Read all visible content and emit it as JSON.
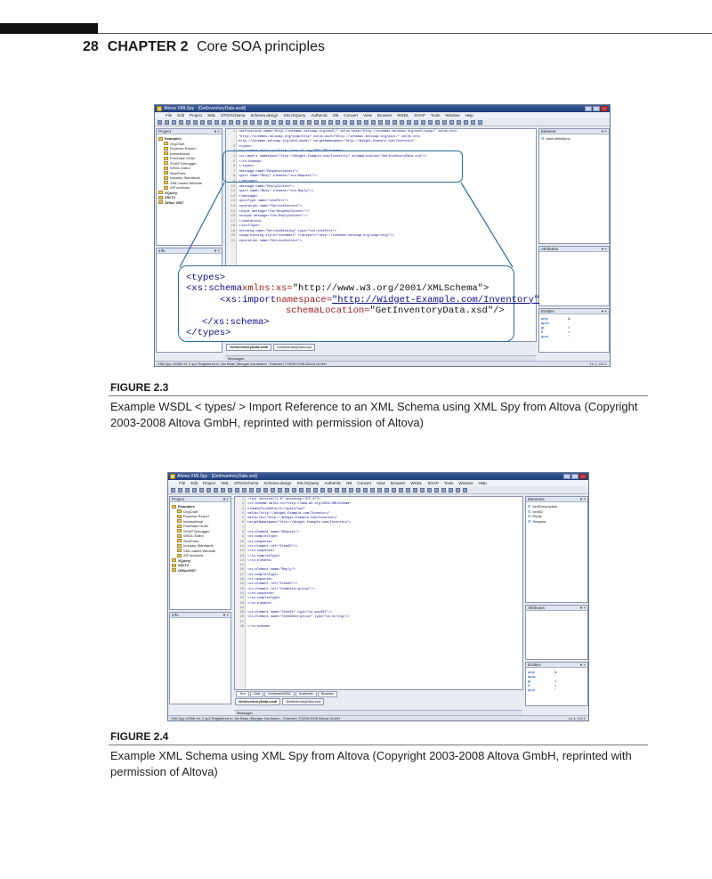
{
  "page": {
    "number": "28",
    "chapter": "CHAPTER 2",
    "chapter_title": "Core SOA principles"
  },
  "figure_2_3": {
    "label": "FIGURE 2.3",
    "caption": "Example WSDL < types/ > Import Reference to an XML Schema using XML Spy from Altova (Copyright 2003-2008 Altova GmbH, reprinted with permission of Altova)",
    "window": {
      "title": "Altova XMLSpy - [GetInventoryData.wsdl]",
      "menu": [
        "File",
        "Edit",
        "Project",
        "XML",
        "DTD/Schema",
        "Schema design",
        "XSL/XQuery",
        "Authentic",
        "DB",
        "Convert",
        "View",
        "Browser",
        "WSDL",
        "SOAP",
        "Tools",
        "Window",
        "Help"
      ],
      "project_pane_title": "Project",
      "project_tree": [
        {
          "label": "Examples",
          "kind": "root"
        },
        {
          "label": "OrgChart",
          "kind": "child"
        },
        {
          "label": "Expense Report",
          "kind": "child"
        },
        {
          "label": "International",
          "kind": "child"
        },
        {
          "label": "Purchase Order",
          "kind": "child"
        },
        {
          "label": "SOAP Debugger",
          "kind": "child"
        },
        {
          "label": "WSDL Editor",
          "kind": "child"
        },
        {
          "label": "SinePorts",
          "kind": "child"
        },
        {
          "label": "Industry Standards",
          "kind": "child"
        },
        {
          "label": "XML-based Website",
          "kind": "child"
        },
        {
          "label": "ZIP archives",
          "kind": "child"
        },
        {
          "label": "XQuery",
          "kind": "bold"
        },
        {
          "label": "XSLT2",
          "kind": "bold"
        },
        {
          "label": "Office 2007",
          "kind": "bold"
        }
      ],
      "info_pane_title": "Info",
      "element_pane_title": "Element",
      "element_items": [
        "wsdl:definitions"
      ],
      "attributes_pane_title": "Attributes",
      "entities_pane_title": "Entities",
      "entities": [
        {
          "name": "amp",
          "value": "&"
        },
        {
          "name": "apos",
          "value": "'"
        },
        {
          "name": "gt",
          "value": ">"
        },
        {
          "name": "lt",
          "value": "<"
        },
        {
          "name": "quot",
          "value": "\""
        }
      ],
      "code_lines": [
        {
          "n": "1",
          "t": "<definitions name=\"http://schemas.xmlsoap.org/wsdl/\" xmlns:soap=\"http://schemas.xmlsoap.org/wsdl/soap/\" xmlns:xsd="
        },
        {
          "n": "",
          "t": "\"http://schemas.xmlsoap.org/soap/http\" xmlns:wsdl=\"http://schemas.xmlsoap.org/wsdl/\" xmlns:tns="
        },
        {
          "n": "",
          "t": "http://schemas.xmlsoap.org/wsdl/mime/\" targetNamespace=\"http://Widget-Example.com/Inventory\""
        },
        {
          "n": "2",
          "t": "<types>"
        },
        {
          "n": "3",
          "t": "  <xs:schema xmlns:xs=\"http://www.w3.org/2001/XMLSchema\">"
        },
        {
          "n": "4",
          "t": "    <xs:import namespace=\"http://Widget-Example.com/Inventory\" schemaLocation=\"GetInventoryData.xsd\"/>"
        },
        {
          "n": "5",
          "t": "  </xs:schema>"
        },
        {
          "n": "6",
          "t": "</types>"
        },
        {
          "n": "7",
          "t": "<message name=\"RequestContext\">"
        },
        {
          "n": "8",
          "t": "  <part name=\"Body\" element=\"tns:Request\"/>"
        },
        {
          "n": "9",
          "t": "</message>"
        },
        {
          "n": "10",
          "t": "<message name=\"ReplyContext\">"
        },
        {
          "n": "11",
          "t": "  <part name=\"Body\" element=\"tns:Reply\"/>"
        },
        {
          "n": "12",
          "t": "</message>"
        },
        {
          "n": "13",
          "t": "<portType name=\"testPort\">"
        },
        {
          "n": "14",
          "t": "  <operation name=\"ServiceContext\">"
        },
        {
          "n": "15",
          "t": "    <input message=\"tns:RequestContext\"/>"
        },
        {
          "n": "16",
          "t": "    <output message=\"tns:ReplyContext\"/>"
        },
        {
          "n": "17",
          "t": "  </operation>"
        },
        {
          "n": "18",
          "t": "</portType>"
        },
        {
          "n": "19",
          "t": "<binding name=\"ServiceBinding\" type=\"tns:testPort\">"
        },
        {
          "n": "20",
          "t": "  <soap:binding style=\"document\" transport=\"http://schemas.xmlsoap.org/soap/http\"/>"
        },
        {
          "n": "21",
          "t": "  <operation name=\"ServiceContext\">"
        }
      ],
      "callout": {
        "line1_tag": "<types>",
        "line2_tag": "<xs:schema",
        "line2_attr": "xmlns:xs=",
        "line2_val": "\"http://www.w3.org/2001/XMLSchema\">",
        "line3_tag": "<xs:import",
        "line3_attr": "namespace=",
        "line3_val": "\"http://Widget-Example.com/Inventory\"",
        "line4_attr": "schemaLocation=",
        "line4_val": "\"GetInventoryData.xsd\"/>",
        "line5_tag": "</xs:schema>",
        "line6_tag": "</types>"
      },
      "doc_tabs": [
        "GetInventoryData.wsdl",
        "GetInventoryData.xsd"
      ],
      "messages_label": "Messages",
      "status_left": "XMLSpy v2008 rel. 2 sp2  Registered to Jim Bean (Morgan Kaufmann - Elsevier)  ©1998-2008 Altova GmbH",
      "status_right": "Ln 1, Col 1"
    }
  },
  "figure_2_4": {
    "label": "FIGURE 2.4",
    "caption": "Example XML Schema using XML Spy from Altova (Copyright 2003-2008 Altova GmbH, reprinted with permission of Altova)",
    "window": {
      "title": "Altova XMLSpy - [GetInventoryData.xsd]",
      "menu": [
        "File",
        "Edit",
        "Project",
        "XML",
        "DTD/Schema",
        "Schema design",
        "XSL/XQuery",
        "Authentic",
        "DB",
        "Convert",
        "View",
        "Browser",
        "WSDL",
        "SOAP",
        "Tools",
        "Window",
        "Help"
      ],
      "project_pane_title": "Project",
      "project_tree": [
        {
          "label": "Examples",
          "kind": "root"
        },
        {
          "label": "OrgChart",
          "kind": "child"
        },
        {
          "label": "Expense Report",
          "kind": "child"
        },
        {
          "label": "International",
          "kind": "child"
        },
        {
          "label": "Purchase Order",
          "kind": "child"
        },
        {
          "label": "SOAP Debugger",
          "kind": "child"
        },
        {
          "label": "WSDL Editor",
          "kind": "child"
        },
        {
          "label": "SinePorts",
          "kind": "child"
        },
        {
          "label": "Industry Standards",
          "kind": "child"
        },
        {
          "label": "XML-based Website",
          "kind": "child"
        },
        {
          "label": "ZIP archives",
          "kind": "child"
        },
        {
          "label": "XQuery",
          "kind": "bold"
        },
        {
          "label": "XSLT2",
          "kind": "bold"
        },
        {
          "label": "Office2007",
          "kind": "bold"
        }
      ],
      "info_pane_title": "Info",
      "element_pane_title": "Elements",
      "element_items": [
        "ItemDescription",
        "ItemID",
        "Reply",
        "Request"
      ],
      "attributes_pane_title": "Attributes",
      "entities_pane_title": "Entities",
      "entities": [
        {
          "name": "amp",
          "value": "&"
        },
        {
          "name": "apos",
          "value": "'"
        },
        {
          "name": "gt",
          "value": ">"
        },
        {
          "name": "lt",
          "value": "<"
        },
        {
          "name": "quot",
          "value": "\""
        }
      ],
      "code_lines": [
        {
          "n": "1",
          "t": "<?xml version=\"1.0\" encoding=\"UTF-8\"?>"
        },
        {
          "n": "2",
          "t": "<xs:schema xmlns:xs=\"http://www.w3.org/2001/XMLSchema\""
        },
        {
          "n": "3",
          "t": "    elementFormDefault=\"qualified\""
        },
        {
          "n": "4",
          "t": "    xmlns=\"http://Widget-Example.com/Inventory\""
        },
        {
          "n": "5",
          "t": "    xmlns:tns=\"http://Widget-Example.com/Inventory\""
        },
        {
          "n": "6",
          "t": "    targetNamespace=\"http://Widget-Example.com/Inventory\">"
        },
        {
          "n": "7",
          "t": ""
        },
        {
          "n": "8",
          "t": "  <xs:element name=\"Request\">"
        },
        {
          "n": "9",
          "t": "    <xs:complexType>"
        },
        {
          "n": "10",
          "t": "      <xs:sequence>"
        },
        {
          "n": "11",
          "t": "        <xs:element ref=\"ItemID\"/>"
        },
        {
          "n": "12",
          "t": "      </xs:sequence>"
        },
        {
          "n": "13",
          "t": "    </xs:complexType>"
        },
        {
          "n": "14",
          "t": "  </xs:element>"
        },
        {
          "n": "15",
          "t": ""
        },
        {
          "n": "16",
          "t": "  <xs:element name=\"Reply\">"
        },
        {
          "n": "17",
          "t": "    <xs:complexType>"
        },
        {
          "n": "18",
          "t": "      <xs:sequence>"
        },
        {
          "n": "19",
          "t": "        <xs:element ref=\"ItemID\"/>"
        },
        {
          "n": "20",
          "t": "        <xs:element ref=\"ItemDescription\"/>"
        },
        {
          "n": "21",
          "t": "      </xs:sequence>"
        },
        {
          "n": "22",
          "t": "    </xs:complexType>"
        },
        {
          "n": "23",
          "t": "  </xs:element>"
        },
        {
          "n": "24",
          "t": ""
        },
        {
          "n": "25",
          "t": "  <xs:element name=\"ItemID\" type=\"xs:anyURI\"/>"
        },
        {
          "n": "26",
          "t": "  <xs:element name=\"ItemDescription\" type=\"xs:string\"/>"
        },
        {
          "n": "27",
          "t": ""
        },
        {
          "n": "28",
          "t": "</xs:schema>"
        }
      ],
      "view_tabs": [
        "Text",
        "Grid",
        "Schema/WSDL",
        "Authentic",
        "Browser"
      ],
      "doc_tabs": [
        "GetInventoryData.wsdl",
        "GetInventoryData.xsd"
      ],
      "messages_label": "Messages",
      "status_left": "XMLSpy v2008 rel. 2 sp2  Registered to Jim Bean (Morgan Kaufmann - Elsevier)  ©1998-2008 Altova GmbH",
      "status_right": "Ln 1, Col 1"
    }
  }
}
